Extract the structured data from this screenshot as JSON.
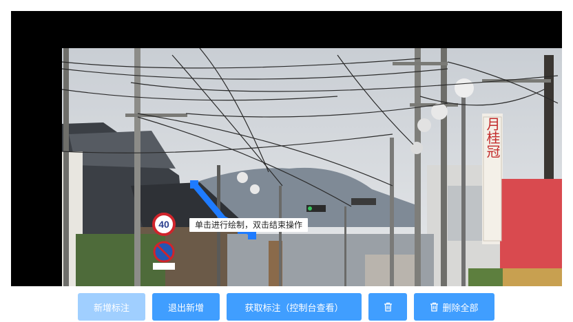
{
  "canvas": {
    "instruction_tooltip": "单击进行绘制，双击结束操作",
    "sign_speed_limit": "40",
    "shop_sign_text": "月桂冠"
  },
  "toolbar": {
    "add_annotation_label": "新增标注",
    "exit_add_label": "退出新增",
    "get_annotation_label": "获取标注（控制台查看）",
    "delete_icon": "trash-icon",
    "delete_all_label": "删除全部",
    "accent_color": "#409eff",
    "disabled_color": "#a0cfff"
  }
}
